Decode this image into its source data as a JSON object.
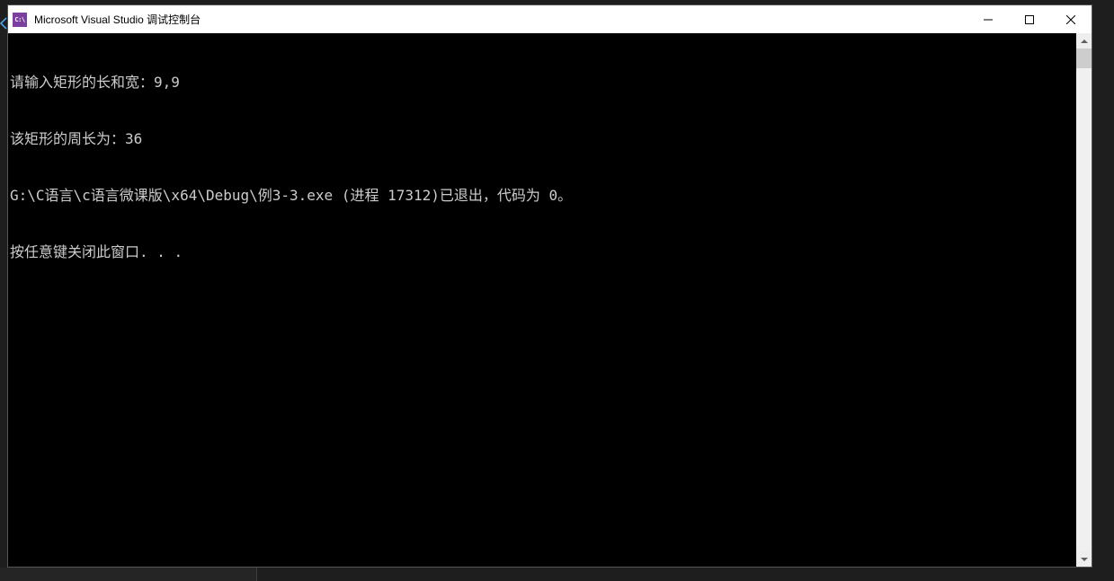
{
  "titlebar": {
    "icon_text": "C:\\",
    "title": "Microsoft Visual Studio 调试控制台"
  },
  "console": {
    "lines": [
      "请输入矩形的长和宽：9,9",
      "该矩形的周长为：36",
      "G:\\C语言\\c语言微课版\\x64\\Debug\\例3-3.exe (进程 17312)已退出，代码为 0。",
      "按任意键关闭此窗口. . ."
    ]
  }
}
